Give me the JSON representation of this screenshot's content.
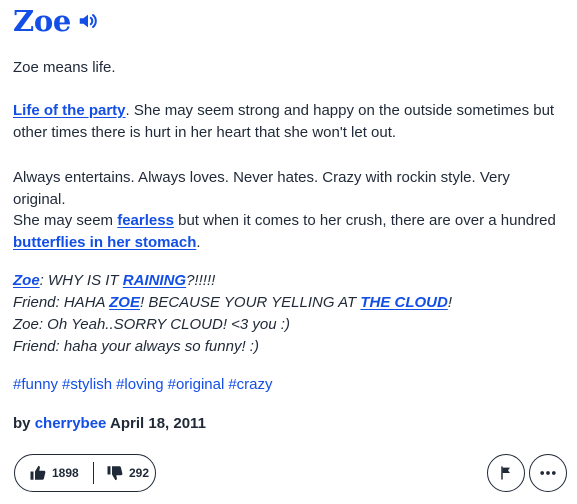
{
  "entry": {
    "word": "Zoe",
    "p1": "Zoe means life.",
    "p2_link": "Life of the party",
    "p2_text": ". She may seem strong and happy on the outside sometimes but other times there is hurt in her heart that she won't let out.",
    "p3": "Always entertains. Always loves. Never hates. Crazy with rockin style. Very original.",
    "p4_a": "She may seem ",
    "p4_link1": "fearless",
    "p4_b": " but when it comes to her crush, there are over a hundred ",
    "p4_link2": "butterflies in her stomach",
    "p4_c": "."
  },
  "example": {
    "l1_link": "Zoe",
    "l1_a": ": WHY IS IT ",
    "l1_link2": "RAINING",
    "l1_b": "?!!!!!",
    "l2_a": "Friend: HAHA ",
    "l2_link": "ZOE",
    "l2_b": "! BECAUSE YOUR YELLING AT ",
    "l2_link2": "THE CLOUD",
    "l2_c": "!",
    "l3": "Zoe: Oh Yeah..SORRY CLOUD! <3 you :)",
    "l4": "Friend: haha your always so funny! :)"
  },
  "tags": [
    "#funny",
    "#stylish",
    "#loving",
    "#original",
    "#crazy"
  ],
  "byline": {
    "prefix": "by ",
    "author": "cherrybee",
    "date": " April 18, 2011"
  },
  "votes": {
    "up": "1898",
    "down": "292"
  },
  "icons": {
    "speaker": "speaker-icon",
    "thumbs_up": "thumbs-up-icon",
    "thumbs_down": "thumbs-down-icon",
    "flag": "flag-icon",
    "more": "more-icon"
  },
  "colors": {
    "link": "#134fe6",
    "text": "#1f2937"
  }
}
